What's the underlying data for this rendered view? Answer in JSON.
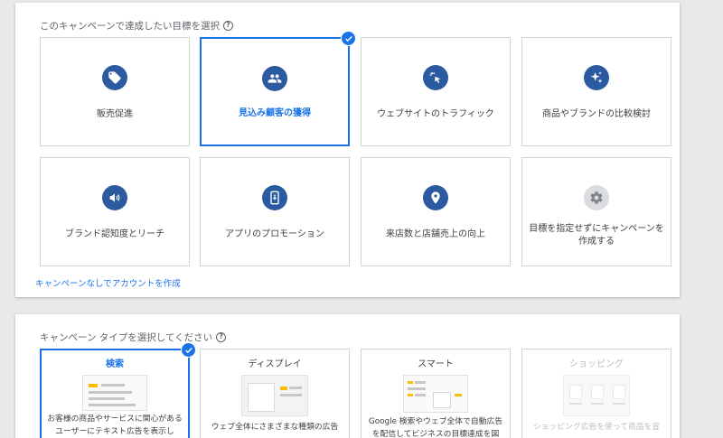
{
  "goal_section": {
    "title": "このキャンペーンで達成したい目標を選択",
    "help_icon": "help-circle-icon",
    "goals": [
      {
        "label": "販売促進",
        "icon": "tag-icon"
      },
      {
        "label": "見込み顧客の獲得",
        "icon": "people-icon"
      },
      {
        "label": "ウェブサイトのトラフィック",
        "icon": "cursor-click-icon"
      },
      {
        "label": "商品やブランドの比較検討",
        "icon": "sparkle-icon"
      },
      {
        "label": "ブランド認知度とリーチ",
        "icon": "megaphone-icon"
      },
      {
        "label": "アプリのプロモーション",
        "icon": "phone-download-icon"
      },
      {
        "label": "来店数と店舗売上の向上",
        "icon": "location-pin-icon"
      },
      {
        "label": "目標を指定せずにキャンペーンを\n作成する",
        "icon": "gear-icon"
      }
    ],
    "no_campaign_link": "キャンペーンなしでアカウントを作成"
  },
  "type_section": {
    "title": "キャンペーン タイプを選択してください",
    "help_icon": "help-circle-icon",
    "types": [
      {
        "title": "検索",
        "desc": "お客様の商品やサービスに関心がある\nユーザーにテキスト広告を表示し"
      },
      {
        "title": "ディスプレイ",
        "desc": "ウェブ全体にさまざまな種類の広告"
      },
      {
        "title": "スマート",
        "desc": "Google 検索やウェブ全体で自動広告\nを配信してビジネスの目標達成を図"
      },
      {
        "title": "ショッピング",
        "desc": "ショッピング広告を使って商品を宣"
      }
    ]
  },
  "colors": {
    "accent": "#1a73e8",
    "icon_bg": "#2c5aa0"
  }
}
